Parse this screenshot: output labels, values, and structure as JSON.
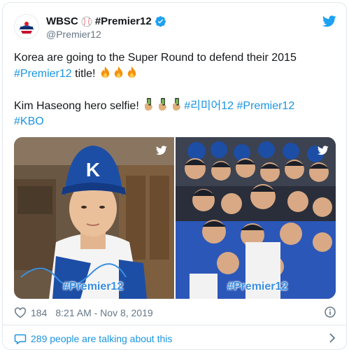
{
  "author": {
    "display_name": "WBSC",
    "display_name_suffix": "#Premier12",
    "handle": "@Premier12",
    "verified": true
  },
  "tweet": {
    "line1_text": "Korea are going to the Super Round to defend their 2015 ",
    "line1_hashtag": "#Premier12",
    "line1_tail": " title! ",
    "line2_text": "Kim Haseong hero selfie! ",
    "line2_hashtag1": "#리미어12",
    "line2_hashtag2": "#Premier12",
    "line2_hashtag3": "#KBO"
  },
  "media": {
    "photo1_watermark": "#Premier12",
    "photo2_watermark": "#Premier12"
  },
  "meta": {
    "like_count": "184",
    "timestamp": "8:21 AM - Nov 8, 2019"
  },
  "footer": {
    "talking_label": "289 people are talking about this"
  },
  "colors": {
    "link": "#1b95e0",
    "secondary": "#657786",
    "twitter_blue": "#1da1f2",
    "border": "#e1e8ed"
  },
  "icons": [
    "wbsc-logo-icon",
    "baseball-icon",
    "verified-icon",
    "twitter-bird-icon",
    "fire-icon",
    "selfie-hand-icon",
    "heart-icon",
    "info-icon",
    "speech-bubble-icon",
    "chevron-right-icon"
  ]
}
